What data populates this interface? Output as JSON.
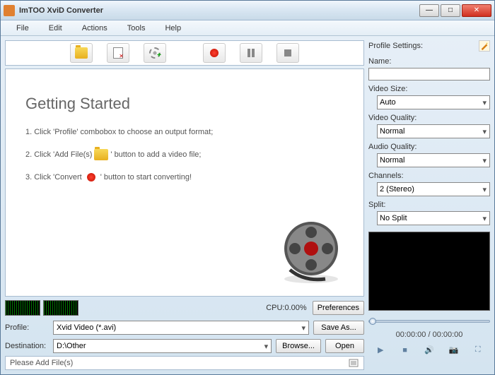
{
  "window": {
    "title": "ImTOO XviD Converter"
  },
  "menu": {
    "file": "File",
    "edit": "Edit",
    "actions": "Actions",
    "tools": "Tools",
    "help": "Help"
  },
  "getting_started": {
    "heading": "Getting Started",
    "step1_a": "1. Click 'Profile' combobox to choose an output format;",
    "step2_a": "2. Click 'Add File(s)",
    "step2_b": "' button to add a video file;",
    "step3_a": "3. Click 'Convert",
    "step3_b": "' button to start converting!"
  },
  "meters": {
    "cpu": "CPU:0.00%",
    "preferences": "Preferences"
  },
  "form": {
    "profile_label": "Profile:",
    "profile_value": "Xvid Video (*.avi)",
    "save_as": "Save As...",
    "dest_label": "Destination:",
    "dest_value": "D:\\Other",
    "browse": "Browse...",
    "open": "Open"
  },
  "status": {
    "text": "Please Add File(s)"
  },
  "settings": {
    "heading": "Profile Settings:",
    "name_label": "Name:",
    "name_value": "",
    "videosize_label": "Video Size:",
    "videosize_value": "Auto",
    "videoquality_label": "Video Quality:",
    "videoquality_value": "Normal",
    "audioquality_label": "Audio Quality:",
    "audioquality_value": "Normal",
    "channels_label": "Channels:",
    "channels_value": "2 (Stereo)",
    "split_label": "Split:",
    "split_value": "No Split"
  },
  "player": {
    "time": "00:00:00 / 00:00:00"
  }
}
